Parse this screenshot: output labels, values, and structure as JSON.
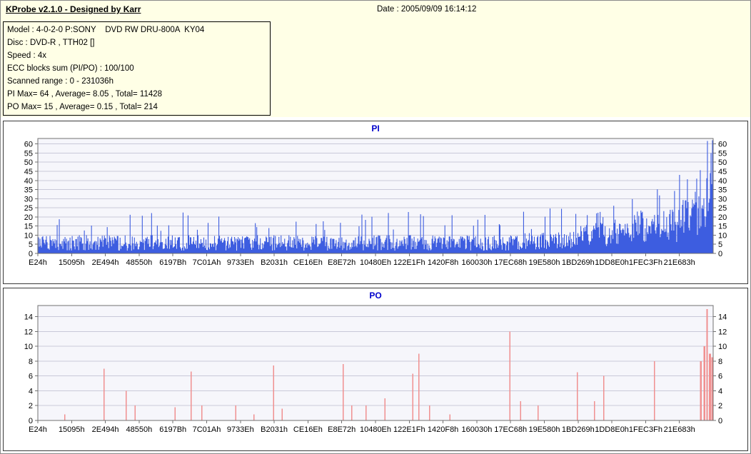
{
  "header": {
    "app_title": "KProbe v2.1.0 - Designed by Karr",
    "date_label": "Date : 2005/09/09 16:14:12"
  },
  "info": {
    "lines": [
      "Model : 4-0-2-0 P:SONY    DVD RW DRU-800A  KY04",
      "Disc : DVD-R , TTH02 []",
      "Speed : 4x",
      "ECC blocks sum (PI/PO) : 100/100",
      "Scanned range : 0 - 231036h",
      "PI Max= 64 , Average= 8.05 , Total= 11428",
      "PO Max= 15 , Average= 0.15 , Total= 214"
    ]
  },
  "chart_data": [
    {
      "id": "pi",
      "type": "bar",
      "title": "PI",
      "color": "#3d5de0",
      "plot_bg": "#f6f6fb",
      "grid_color": "#c9c9d9",
      "axis_color": "#707070",
      "ylim": [
        0,
        63
      ],
      "yticks": [
        0,
        5,
        10,
        15,
        20,
        25,
        30,
        35,
        40,
        45,
        50,
        55,
        60
      ],
      "x_categories": [
        "E24h",
        "15095h",
        "2E494h",
        "48550h",
        "6197Bh",
        "7C01Ah",
        "9733Eh",
        "B2031h",
        "CE16Eh",
        "E8E72h",
        "10480Eh",
        "122E1Fh",
        "1420F8h",
        "160030h",
        "17EC68h",
        "19E580h",
        "1BD269h",
        "1DD8E0h",
        "1FEC3Fh",
        "21E683h"
      ],
      "stats": {
        "max": 64,
        "average": 8.05,
        "total": 11428
      },
      "series_spec": {
        "kind": "noise",
        "n": 944,
        "seed": 20050909,
        "segments": [
          {
            "until": 0.72,
            "base": 1.5,
            "var": 8.5,
            "spike_p": 0.05,
            "spike_lo": 12,
            "spike_hi": 23
          },
          {
            "until": 0.8,
            "base": 2,
            "var": 10,
            "spike_p": 0.06,
            "spike_lo": 13,
            "spike_hi": 26
          },
          {
            "until": 0.88,
            "base": 4,
            "var": 13,
            "spike_p": 0.08,
            "spike_lo": 16,
            "spike_hi": 30
          },
          {
            "until": 0.95,
            "base": 6,
            "var": 18,
            "spike_p": 0.1,
            "spike_lo": 22,
            "spike_hi": 40
          },
          {
            "until": 0.99,
            "base": 10,
            "var": 24,
            "spike_p": 0.12,
            "spike_lo": 28,
            "spike_hi": 48
          },
          {
            "until": 1.0,
            "base": 18,
            "var": 28,
            "spike_p": 0.3,
            "spike_lo": 40,
            "spike_hi": 63
          }
        ],
        "tail": [
          30,
          44,
          55,
          38,
          62
        ]
      }
    },
    {
      "id": "po",
      "type": "bar",
      "title": "PO",
      "color": "#f09090",
      "plot_bg": "#f6f6fb",
      "grid_color": "#c9c9d9",
      "axis_color": "#707070",
      "ylim": [
        0,
        15.5
      ],
      "yticks": [
        0,
        2,
        4,
        6,
        8,
        10,
        12,
        14
      ],
      "x_categories": [
        "E24h",
        "15095h",
        "2E494h",
        "48550h",
        "6197Bh",
        "7C01Ah",
        "9733Eh",
        "B2031h",
        "CE16Eh",
        "E8E72h",
        "10480Eh",
        "122E1Fh",
        "1420F8h",
        "160030h",
        "17EC68h",
        "19E580h",
        "1BD269h",
        "1DD8E0h",
        "1FEC3Fh",
        "21E683h"
      ],
      "stats": {
        "max": 15,
        "average": 0.15,
        "total": 214
      },
      "series_spec": {
        "kind": "spikes",
        "spikes": [
          {
            "x": 0.04,
            "v": 0.8
          },
          {
            "x": 0.098,
            "v": 7.0
          },
          {
            "x": 0.131,
            "v": 4.0
          },
          {
            "x": 0.144,
            "v": 2.0
          },
          {
            "x": 0.203,
            "v": 1.8
          },
          {
            "x": 0.227,
            "v": 6.6
          },
          {
            "x": 0.243,
            "v": 2.0
          },
          {
            "x": 0.293,
            "v": 2.0
          },
          {
            "x": 0.32,
            "v": 0.8
          },
          {
            "x": 0.349,
            "v": 7.4
          },
          {
            "x": 0.362,
            "v": 1.6
          },
          {
            "x": 0.452,
            "v": 7.6
          },
          {
            "x": 0.465,
            "v": 2.0
          },
          {
            "x": 0.486,
            "v": 2.0
          },
          {
            "x": 0.514,
            "v": 3.0
          },
          {
            "x": 0.555,
            "v": 6.3
          },
          {
            "x": 0.564,
            "v": 9.0
          },
          {
            "x": 0.58,
            "v": 2.0
          },
          {
            "x": 0.61,
            "v": 0.8
          },
          {
            "x": 0.699,
            "v": 12.0
          },
          {
            "x": 0.715,
            "v": 2.6
          },
          {
            "x": 0.741,
            "v": 2.0
          },
          {
            "x": 0.799,
            "v": 6.5
          },
          {
            "x": 0.824,
            "v": 2.6
          },
          {
            "x": 0.838,
            "v": 6.0
          },
          {
            "x": 0.913,
            "v": 8.0
          },
          {
            "x": 0.982,
            "v": 8.0,
            "w": 2.5
          },
          {
            "x": 0.987,
            "v": 10.0,
            "w": 2.5
          },
          {
            "x": 0.991,
            "v": 15.0,
            "w": 2
          },
          {
            "x": 0.995,
            "v": 9.0,
            "w": 3
          },
          {
            "x": 0.999,
            "v": 8.5,
            "w": 3
          }
        ]
      }
    }
  ]
}
